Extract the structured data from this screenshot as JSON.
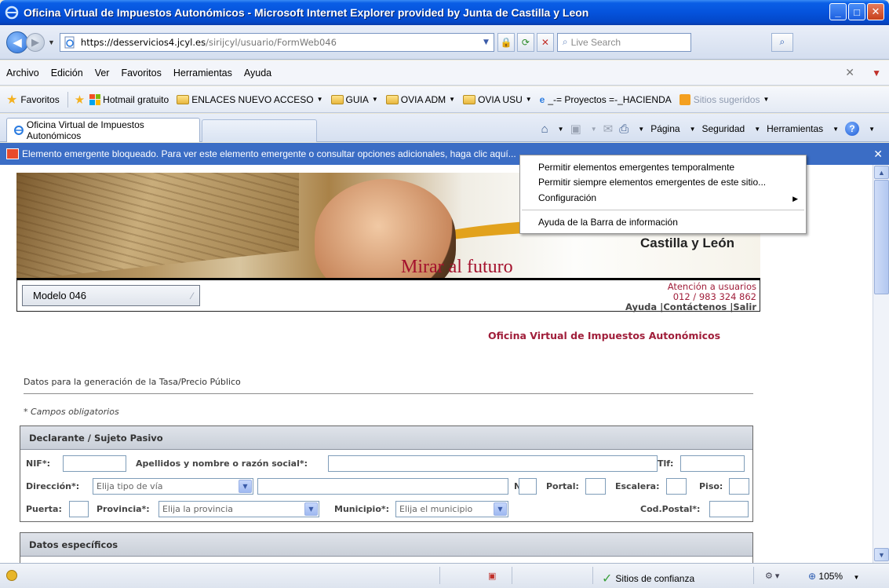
{
  "window": {
    "title": "Oficina Virtual de Impuestos Autonómicos - Microsoft Internet Explorer provided by Junta de Castilla y Leon",
    "minimize": "_",
    "maximize": "□",
    "close": "✕"
  },
  "address": {
    "host": "https://desservicios4.jcyl.es",
    "path": "/sirijcyl/usuario/FormWeb046",
    "search_placeholder": "Live Search"
  },
  "menubar": {
    "items": [
      "Archivo",
      "Edición",
      "Ver",
      "Favoritos",
      "Herramientas",
      "Ayuda"
    ]
  },
  "favorites": {
    "label": "Favoritos",
    "hotmail": "Hotmail gratuito",
    "links": [
      "ENLACES NUEVO ACCESO",
      "GUIA",
      "OVIA ADM",
      "OVIA USU"
    ],
    "proyectos": "_-= Proyectos =-_HACIENDA",
    "sugeridos": "Sitios sugeridos"
  },
  "tab": {
    "title": "Oficina Virtual de Impuestos Autonómicos"
  },
  "commands": {
    "pagina": "Página",
    "seguridad": "Seguridad",
    "herramientas": "Herramientas",
    "help": "?"
  },
  "infobar": {
    "message": "Elemento emergente bloqueado. Para ver este elemento emergente o consultar opciones adicionales, haga clic aquí...",
    "close": "✕"
  },
  "context_menu": {
    "items": [
      "Permitir elementos emergentes temporalmente",
      "Permitir siempre elementos emergentes de este sitio...",
      "Configuración",
      "Ayuda de la Barra de información"
    ]
  },
  "banner": {
    "region": "Castilla y León",
    "motto": "Mirar al futuro"
  },
  "nav": {
    "modelo": "Modelo 046",
    "attention": "Atención a usuarios",
    "phone": "012 / 983 324 862",
    "links": "Ayuda |Contáctenos |Salir"
  },
  "page": {
    "heading": "Oficina Virtual de Impuestos Autonómicos",
    "section_title": "Datos para la generación de la Tasa/Precio Público",
    "required_note": "* Campos obligatorios"
  },
  "declarante": {
    "title": "Declarante / Sujeto Pasivo",
    "nif": "NIF*:",
    "apellidos": "Apellidos y nombre o razón social*:",
    "tlf": "Tlf:",
    "direccion": "Dirección*:",
    "via_select": "Elija tipo de vía",
    "numero": "Nº*:",
    "portal": "Portal:",
    "escalera": "Escalera:",
    "piso": "Piso:",
    "puerta": "Puerta:",
    "provincia": "Provincia*:",
    "provincia_select": "Elija la provincia",
    "municipio": "Municipio*:",
    "municipio_select": "Elija el municipio",
    "cp": "Cod.Postal*:"
  },
  "especificos": {
    "title": "Datos específicos"
  },
  "status": {
    "zone": "Sitios de confianza",
    "zoom": "105%"
  }
}
